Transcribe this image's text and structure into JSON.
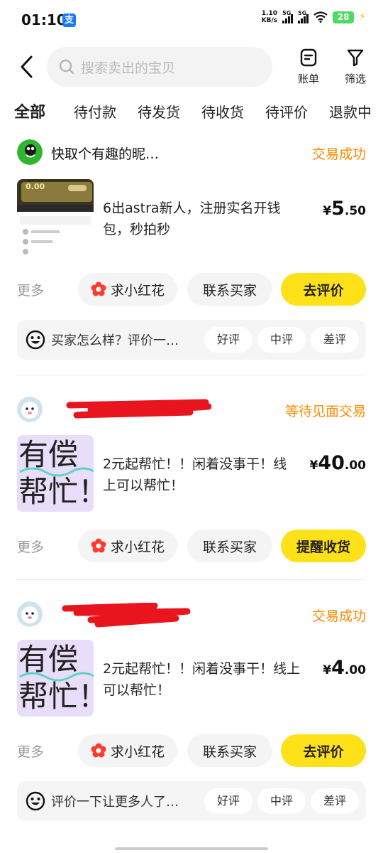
{
  "status_bar": {
    "time": "01:10",
    "alipay_glyph": "支",
    "net_speed_value": "1.10",
    "net_speed_unit": "KB/s",
    "sim1_label": "5G",
    "sim2_label": "5G",
    "battery_level": "28"
  },
  "header": {
    "search_placeholder": "搜索卖出的宝贝",
    "bill_label": "账单",
    "filter_label": "筛选"
  },
  "tabs": [
    {
      "label": "全部",
      "active": true
    },
    {
      "label": "待付款",
      "active": false
    },
    {
      "label": "待发货",
      "active": false
    },
    {
      "label": "待收货",
      "active": false
    },
    {
      "label": "待评价",
      "active": false
    },
    {
      "label": "退款中",
      "active": false
    }
  ],
  "orders": [
    {
      "buyer_name": "快取个有趣的昵…",
      "status": "交易成功",
      "thumb_price": "0.00",
      "title": "6出astra新人，注册实名开钱包，秒拍秒",
      "price_currency": "¥",
      "price_int": "5",
      "price_dec": ".50",
      "more_label": "更多",
      "flower_label": "求小红花",
      "contact_label": "联系买家",
      "primary_label": "去评价",
      "review_prompt": "买家怎么样？评价一…",
      "review_good": "好评",
      "review_mid": "中评",
      "review_bad": "差评"
    },
    {
      "buyer_name": "",
      "status": "等待见面交易",
      "thumb_line1": "有偿",
      "thumb_line2": "帮忙！",
      "title": "2元起帮忙！！闲着没事干！线上可以帮忙！",
      "price_currency": "¥",
      "price_int": "40",
      "price_dec": ".00",
      "more_label": "更多",
      "flower_label": "求小红花",
      "contact_label": "联系买家",
      "primary_label": "提醒收货"
    },
    {
      "buyer_name": "",
      "status": "交易成功",
      "thumb_line1": "有偿",
      "thumb_line2": "帮忙！",
      "title": "2元起帮忙！！闲着没事干！线上可以帮忙！",
      "price_currency": "¥",
      "price_int": "4",
      "price_dec": ".00",
      "more_label": "更多",
      "flower_label": "求小红花",
      "contact_label": "联系买家",
      "primary_label": "去评价",
      "review_prompt": "评价一下让更多人了…",
      "review_good": "好评",
      "review_mid": "中评",
      "review_bad": "差评"
    }
  ],
  "colors": {
    "accent_yellow": "#ffe11a",
    "status_orange": "#ff8a00",
    "redaction_red": "#e8141e"
  }
}
